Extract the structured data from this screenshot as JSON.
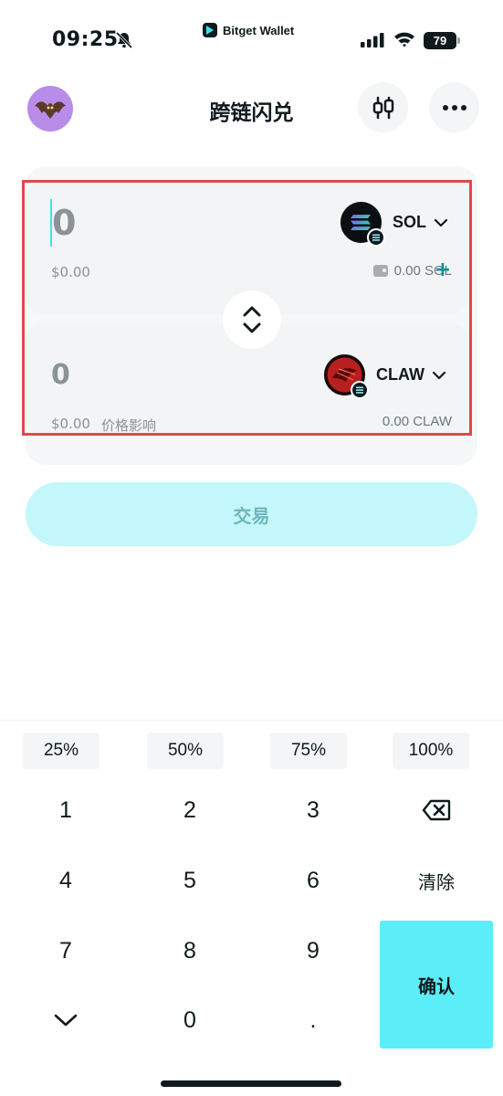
{
  "status_bar": {
    "time": "09:25",
    "app_name": "Bitget Wallet",
    "battery": "79"
  },
  "header": {
    "title": "跨链闪兑",
    "avatar_icon": "bat-avatar-icon",
    "settings_icon": "chart-settings-icon",
    "more_icon": "more-dots-icon"
  },
  "pay": {
    "amount": "0",
    "usd_value": "$0.00",
    "token": "SOL",
    "balance": "0.00 SOL",
    "add_label": "+"
  },
  "receive": {
    "amount": "0",
    "usd_value": "$0.00",
    "price_impact_label": "价格影响",
    "token": "CLAW",
    "balance": "0.00 CLAW"
  },
  "trade_button": "交易",
  "keyboard": {
    "percents": [
      "25%",
      "50%",
      "75%",
      "100%"
    ],
    "keys": [
      "1",
      "2",
      "3",
      "4",
      "5",
      "6",
      "7",
      "8",
      "9",
      "0",
      "."
    ],
    "clear": "清除",
    "confirm": "确认"
  },
  "colors": {
    "accent": "#5ceef8",
    "trade_disabled": "#c3f7fb",
    "highlight": "#e14848"
  }
}
